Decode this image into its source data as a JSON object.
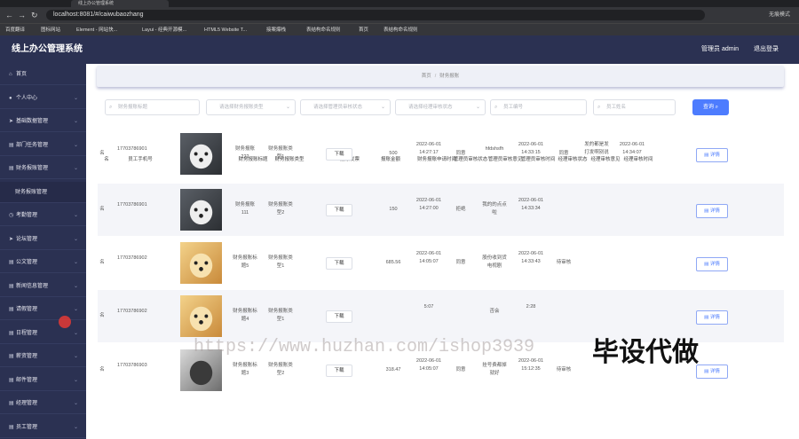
{
  "browser": {
    "tab_title": "线上办公管理系统",
    "url": "localhost:8081/#/caiwubaozhang",
    "profile": "无痕模式",
    "bookmarks": [
      "百度翻译",
      "图标网站",
      "Element - 网站快...",
      "Layui - 经典开源模...",
      "HTML5 Website T...",
      "接案爆栈",
      "表结构命名规则",
      "首页",
      "表结构命名规则"
    ]
  },
  "app": {
    "title": "线上办公管理系统",
    "user": "管理员 admin",
    "logout": "退出登录"
  },
  "sidebar": [
    {
      "label": "首页",
      "icon": "home-icon",
      "sub": false
    },
    {
      "label": "个人中心",
      "icon": "user-icon",
      "sub": false
    },
    {
      "label": "基础数据管理",
      "icon": "send-icon",
      "sub": false
    },
    {
      "label": "部门任务管理",
      "icon": "doc-icon",
      "sub": false
    },
    {
      "label": "财务报账管理",
      "icon": "doc-icon",
      "sub": false
    },
    {
      "label": "财务报账管理",
      "icon": "",
      "sub": true
    },
    {
      "label": "考勤管理",
      "icon": "clock-icon",
      "sub": false
    },
    {
      "label": "论坛管理",
      "icon": "send-icon",
      "sub": false
    },
    {
      "label": "公文管理",
      "icon": "doc-icon",
      "sub": false
    },
    {
      "label": "新闻信息管理",
      "icon": "doc-icon",
      "sub": false
    },
    {
      "label": "请假管理",
      "icon": "doc-icon",
      "sub": false
    },
    {
      "label": "日程管理",
      "icon": "doc-icon",
      "sub": false
    },
    {
      "label": "薪资管理",
      "icon": "doc-icon",
      "sub": false
    },
    {
      "label": "邮件管理",
      "icon": "doc-icon",
      "sub": false
    },
    {
      "label": "经理管理",
      "icon": "doc-icon",
      "sub": false
    },
    {
      "label": "员工管理",
      "icon": "doc-icon",
      "sub": false
    }
  ],
  "breadcrumb": {
    "home": "首页",
    "current": "财务报账"
  },
  "filters": [
    "财务报账标题",
    "请选择财务报账类型",
    "请选择管理员审核状态",
    "请选择经理审核状态",
    "员工编号",
    "员工姓名"
  ],
  "query_label": "查询",
  "table": {
    "headers": [
      "名",
      "员工手机号",
      "员工头像",
      "财务报账标题",
      "财务报账类型",
      "报账发票",
      "报账金额",
      "财务报账申请时间",
      "管理员审核状态",
      "管理员审核意见",
      "管理员审核时间",
      "经理审核状态",
      "经理审核意见",
      "经理审核时间",
      "操作"
    ],
    "download_label": "下载",
    "detail_label": "详情",
    "rows": [
      {
        "name": "名",
        "phone": "17703786901",
        "avatar": "husky",
        "title": "财务报账222",
        "type": "财务报账类型1",
        "amount": "500",
        "apply": "2022-06-01 14:27:17",
        "admin_status": "同意",
        "admin_note": "hfdshsfh",
        "admin_time": "2022-06-01 14:33:15",
        "mgr_status": "同意",
        "mgr_note": "发的都是发打发啊别说",
        "mgr_time": "2022-06-01 14:34:07"
      },
      {
        "name": "名",
        "phone": "17703786901",
        "avatar": "husky",
        "title": "财务报账111",
        "type": "财务报账类型2",
        "amount": "150",
        "apply": "2022-06-01 14:27:00",
        "admin_status": "拒绝",
        "admin_note": "我的的点点啦",
        "admin_time": "2022-06-01 14:33:34",
        "mgr_status": "",
        "mgr_note": "",
        "mgr_time": ""
      },
      {
        "name": "名",
        "phone": "17703786902",
        "avatar": "puppy",
        "title": "财务报账标题5",
        "type": "财务报账类型1",
        "amount": "685.56",
        "apply": "2022-06-01 14:05:07",
        "admin_status": "同意",
        "admin_note": "股份收到货电视剧",
        "admin_time": "2022-06-01 14:33:43",
        "mgr_status": "待审核",
        "mgr_note": "",
        "mgr_time": ""
      },
      {
        "name": "名",
        "phone": "17703786902",
        "avatar": "puppy",
        "title": "财务报账标题4",
        "type": "财务报账类型1",
        "amount": "",
        "apply": "5:07",
        "admin_status": "",
        "admin_note": "否会",
        "admin_time": "2:28",
        "mgr_status": "",
        "mgr_note": "",
        "mgr_time": ""
      },
      {
        "name": "名",
        "phone": "17703786903",
        "avatar": "person",
        "title": "财务报账标题3",
        "type": "财务报账类型2",
        "amount": "318.47",
        "apply": "2022-06-01 14:05:07",
        "admin_status": "同意",
        "admin_note": "挂号费都掉就好",
        "admin_time": "2022-06-01 15:12:35",
        "mgr_status": "待审核",
        "mgr_note": "",
        "mgr_time": ""
      }
    ]
  },
  "watermark": {
    "url": "https://www.huzhan.com/ishop3939",
    "slogan": "毕设代做"
  },
  "colors": {
    "sidebar": "#2b3152",
    "accent": "#4d7cfe"
  }
}
